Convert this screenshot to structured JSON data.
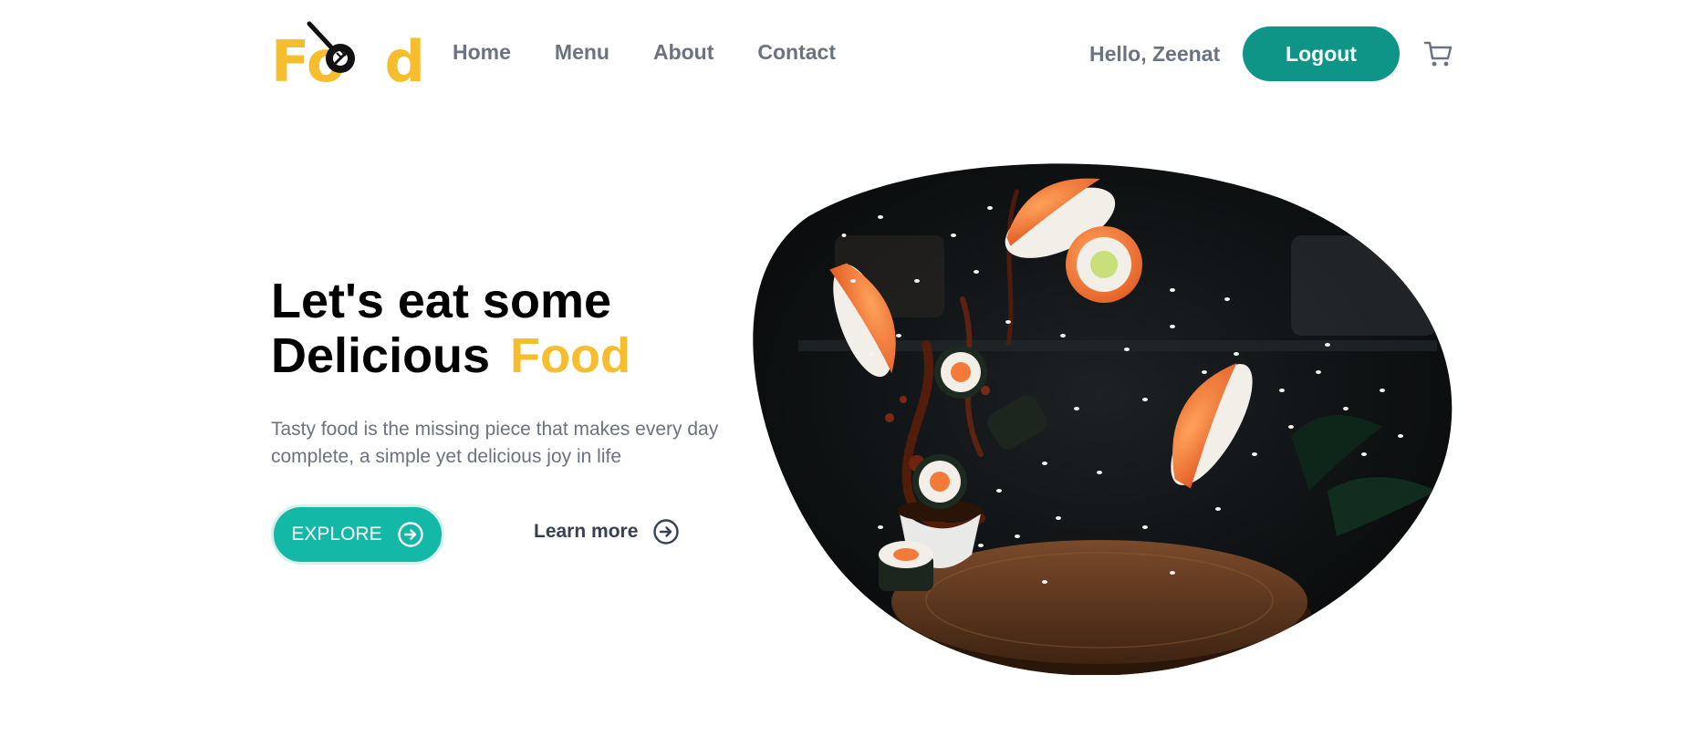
{
  "logo": {
    "text_pre": "Fo",
    "text_post": "d"
  },
  "nav": {
    "items": [
      {
        "label": "Home"
      },
      {
        "label": "Menu"
      },
      {
        "label": "About"
      },
      {
        "label": "Contact"
      }
    ]
  },
  "user": {
    "greeting": "Hello, Zeenat",
    "logout_label": "Logout"
  },
  "hero": {
    "title_line1": "Let's eat some",
    "title_line2": "Delicious",
    "title_accent": "Food",
    "description": "Tasty food is the missing piece that makes every day complete, a simple yet delicious joy in life",
    "explore_label": "EXPLORE",
    "learn_more_label": "Learn more"
  },
  "icons": {
    "logo": "spoon-fork-icon",
    "cart": "cart-icon",
    "explore_arrow": "circle-arrow-right-icon",
    "learn_more_arrow": "circle-arrow-right-icon"
  },
  "colors": {
    "brand_yellow": "#f6bd2c",
    "logout_teal": "#0f9488",
    "explore_teal": "#14b8a6",
    "nav_gray": "#6b7280"
  }
}
